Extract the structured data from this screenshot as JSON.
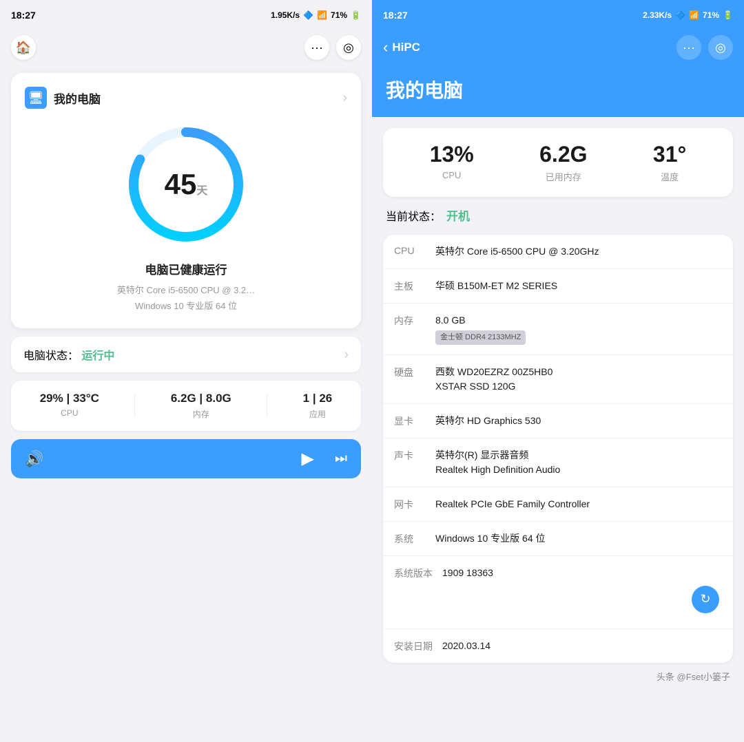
{
  "left": {
    "status_bar": {
      "time": "18:27",
      "speed": "1.95K/s",
      "battery": "71%"
    },
    "nav": {
      "home_icon": "🏠",
      "more_icon": "···",
      "target_icon": "◎"
    },
    "main_card": {
      "title": "我的电脑",
      "days": "45",
      "days_unit": "天",
      "health_text": "电脑已健康运行",
      "cpu_text": "英特尔 Core i5-6500 CPU @ 3.2…",
      "os_text": "Windows 10 专业版 64 位"
    },
    "status_row": {
      "label": "电脑状态：",
      "value": "运行中"
    },
    "metrics": [
      {
        "value": "29% | 33°C",
        "label": "CPU"
      },
      {
        "value": "6.2G | 8.0G",
        "label": "内存"
      },
      {
        "value": "1 | 26",
        "label": "应用"
      }
    ],
    "player": {
      "volume_icon": "🔊",
      "play_icon": "▶",
      "skip_icon": "⏭"
    }
  },
  "right": {
    "status_bar": {
      "time": "18:27",
      "speed": "2.33K/s",
      "battery": "71%"
    },
    "nav": {
      "back_label": "HiPC",
      "more_icon": "···",
      "target_icon": "◎"
    },
    "page_title": "我的电脑",
    "stats": [
      {
        "value": "13%",
        "label": "CPU"
      },
      {
        "value": "6.2G",
        "label": "已用内存"
      },
      {
        "value": "31°",
        "label": "温度"
      }
    ],
    "current_status": {
      "label": "当前状态：",
      "value": "开机"
    },
    "info_rows": [
      {
        "key": "CPU",
        "value": "英特尔 Core i5-6500 CPU @ 3.20GHz",
        "badge": null
      },
      {
        "key": "主板",
        "value": "华硕 B150M-ET M2 SERIES",
        "badge": null
      },
      {
        "key": "内存",
        "value": "8.0 GB",
        "badge": "金士顿 DDR4 2133MHZ"
      },
      {
        "key": "硬盘",
        "value": "西数 WD20EZRZ 00Z5HB0\nXSTAR SSD 120G",
        "badge": null
      },
      {
        "key": "显卡",
        "value": "英特尔 HD Graphics 530",
        "badge": null
      },
      {
        "key": "声卡",
        "value": "英特尔(R) 显示器音频\nRealtek High Definition Audio",
        "badge": null
      },
      {
        "key": "网卡",
        "value": "Realtek PCIe GbE Family Controller",
        "badge": null
      },
      {
        "key": "系统",
        "value": "Windows 10 专业版 64 位",
        "badge": null
      },
      {
        "key": "系统版本",
        "value": "1909 18363",
        "badge": null
      },
      {
        "key": "安装日期",
        "value": "2020.03.14",
        "badge": null
      }
    ],
    "watermark": "头条 @Fset小篓子"
  }
}
